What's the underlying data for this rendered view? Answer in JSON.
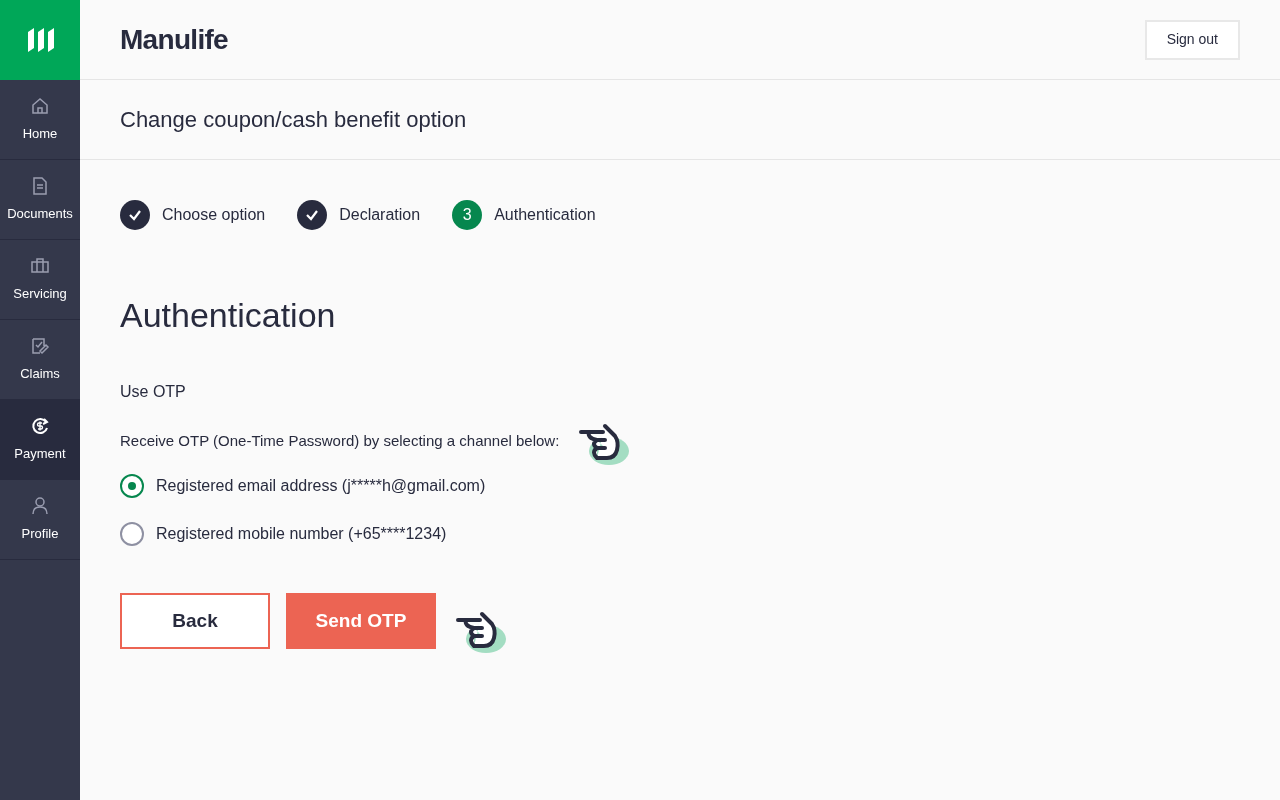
{
  "brand": "Manulife",
  "sign_out": "Sign out",
  "sidebar": {
    "items": [
      {
        "label": "Home",
        "kind": "home",
        "selected": false
      },
      {
        "label": "Documents",
        "kind": "document",
        "selected": false
      },
      {
        "label": "Servicing",
        "kind": "briefcase",
        "selected": false
      },
      {
        "label": "Claims",
        "kind": "claim",
        "selected": false
      },
      {
        "label": "Payment",
        "kind": "payment",
        "selected": true
      },
      {
        "label": "Profile",
        "kind": "person",
        "selected": false
      }
    ]
  },
  "page_title": "Change coupon/cash benefit option",
  "steps": [
    {
      "label": "Choose option",
      "completed": true
    },
    {
      "label": "Declaration",
      "completed": true
    },
    {
      "label": "Authentication",
      "completed": false,
      "number": "3"
    }
  ],
  "heading": "Authentication",
  "section_label": "Use OTP",
  "instruction": "Receive OTP (One-Time Password) by selecting a channel below:",
  "channels": [
    {
      "label": "Registered email address (j*****h@gmail.com)",
      "selected": true
    },
    {
      "label": "Registered mobile number (+65****1234)",
      "selected": false
    }
  ],
  "buttons": [
    {
      "label": "Back",
      "kind": "secondary"
    },
    {
      "label": "Send OTP",
      "kind": "primary"
    }
  ]
}
